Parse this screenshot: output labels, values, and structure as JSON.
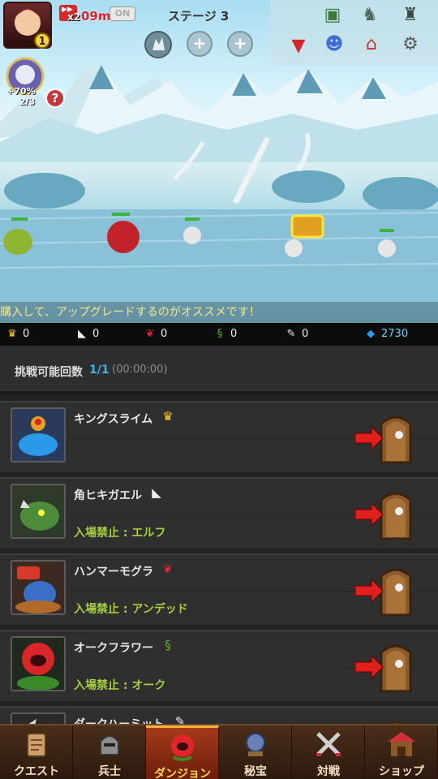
{
  "header": {
    "player_level": "1",
    "speed": "x2",
    "timer": "09m",
    "auto_toggle": "ON",
    "stage": "ステージ 3",
    "slot_plus": "+"
  },
  "pet": {
    "bonus": "+70%",
    "count": "2/3",
    "help": "?"
  },
  "ticker": "購入して、アップグレードするのがオススメです！",
  "resources": [
    {
      "icon": "crown-icon",
      "value": "0"
    },
    {
      "icon": "fang-icon",
      "value": "0"
    },
    {
      "icon": "red-claw-icon",
      "value": "0"
    },
    {
      "icon": "vine-icon",
      "value": "0"
    },
    {
      "icon": "feather-icon",
      "value": "0"
    },
    {
      "icon": "diamond-icon",
      "value": "2730"
    }
  ],
  "attempts": {
    "label": "挑戦可能回数",
    "value": "1/1",
    "time": "(00:00:00)"
  },
  "dungeons": [
    {
      "name": "キングスライム",
      "ban": ""
    },
    {
      "name": "角ヒキガエル",
      "ban": "入場禁止 : エルフ"
    },
    {
      "name": "ハンマーモグラ",
      "ban": "入場禁止 : アンデッド"
    },
    {
      "name": "オークフラワー",
      "ban": "入場禁止 : オーク"
    },
    {
      "name": "ダークハーミット",
      "ban": ""
    }
  ],
  "nav": [
    {
      "label": "クエスト"
    },
    {
      "label": "兵士"
    },
    {
      "label": "ダンジョン"
    },
    {
      "label": "秘宝"
    },
    {
      "label": "対戦"
    },
    {
      "label": "ショップ"
    }
  ],
  "colors": {
    "accent_blue": "#41b3e8",
    "ban_green": "#a5cf3d",
    "active_tab": "#ffd83c",
    "arrow_red": "#e0201c"
  }
}
